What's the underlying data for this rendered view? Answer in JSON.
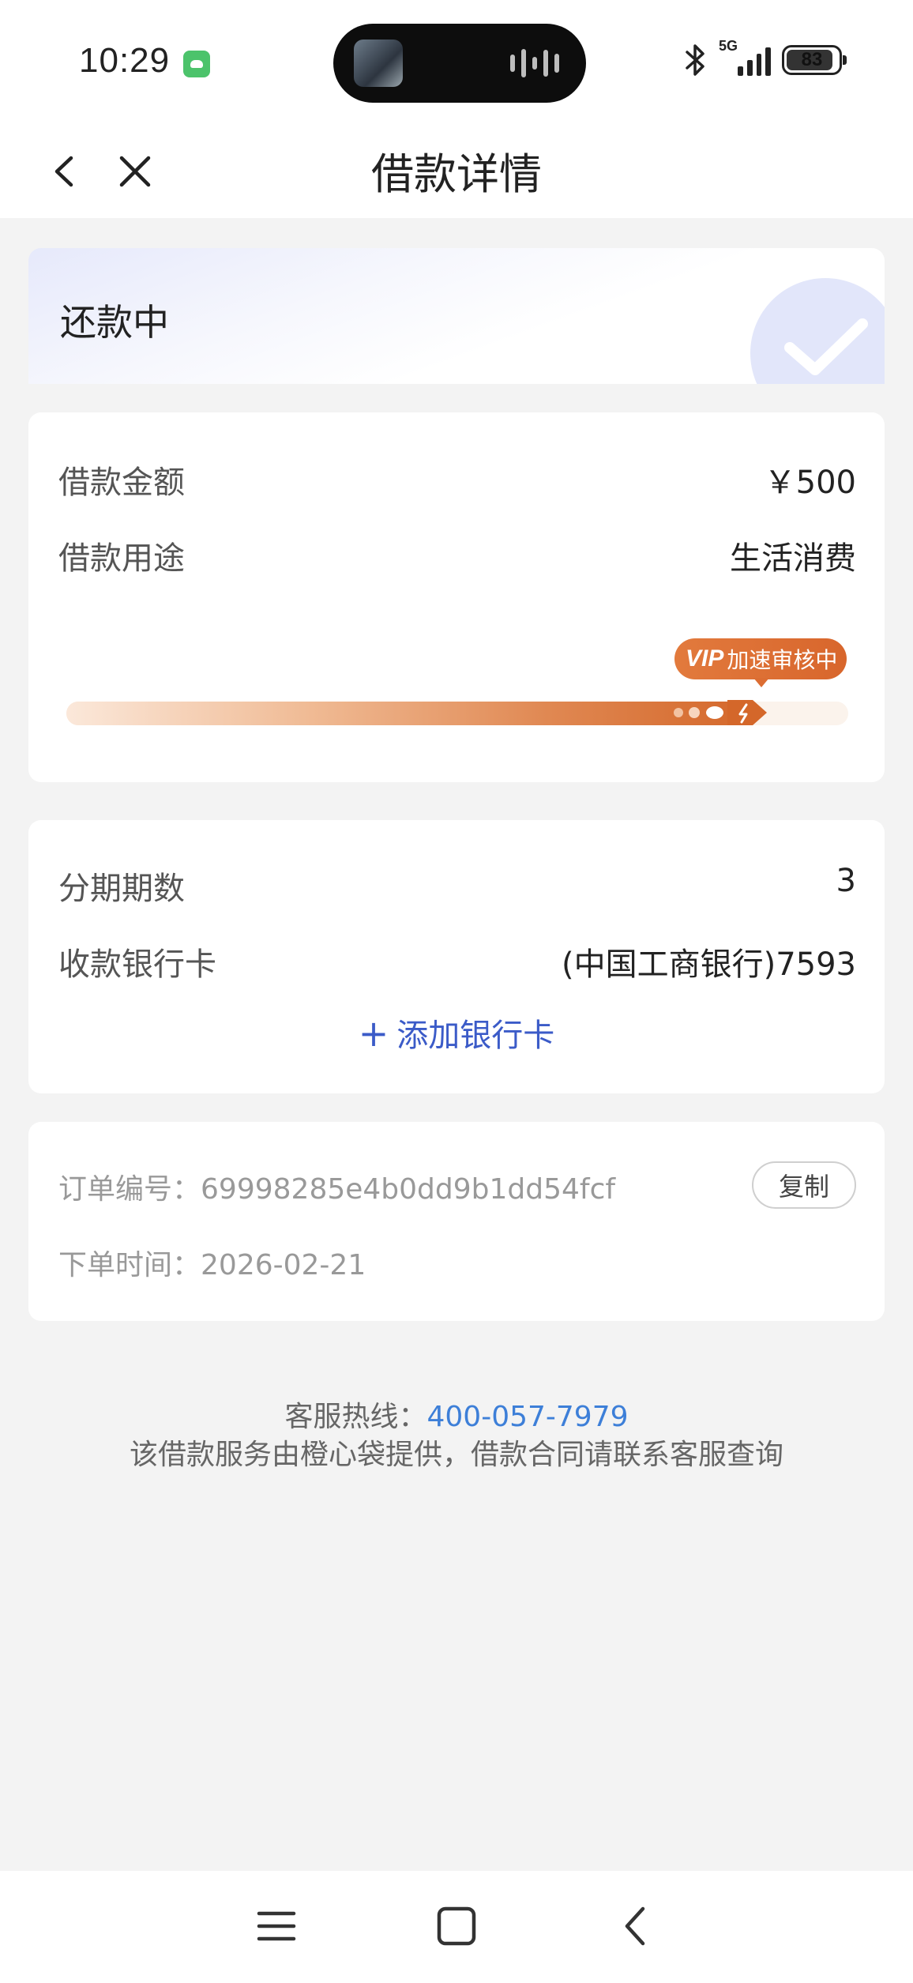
{
  "status_bar": {
    "time": "10:29",
    "network": "5G",
    "battery": "83",
    "icons": [
      "app-notification-icon",
      "bluetooth-icon",
      "signal-icon",
      "battery-icon"
    ]
  },
  "nav": {
    "title": "借款详情",
    "back_icon": "chevron-left-icon",
    "close_icon": "close-icon"
  },
  "loan_status": {
    "label": "还款中",
    "icon": "check-icon"
  },
  "loan_info": {
    "amount_label": "借款金额",
    "amount_value": "￥500",
    "purpose_label": "借款用途",
    "purpose_value": "生活消费",
    "vip_mark": "VIP",
    "vip_text": "加速审核中",
    "progress": 0.88
  },
  "repayment": {
    "periods_label": "分期期数",
    "periods_value": "3",
    "bank_label": "收款银行卡",
    "bank_value": "(中国工商银行)7593",
    "add_card_label": "添加银行卡"
  },
  "order": {
    "number_label": "订单编号：",
    "number_value": "69998285e4b0dd9b1dd54fcf",
    "copy_label": "复制",
    "time_label": "下单时间：",
    "time_value": "2026-02-21"
  },
  "footer": {
    "hotline_label": "客服热线：",
    "hotline_number": "400-057-7979",
    "note": "该借款服务由橙心袋提供，借款合同请联系客服查询"
  },
  "colors": {
    "accent_blue": "#3b5bc8",
    "link_blue": "#3d7fd8",
    "vip_orange": "#d8662c",
    "background": "#f3f3f3"
  }
}
